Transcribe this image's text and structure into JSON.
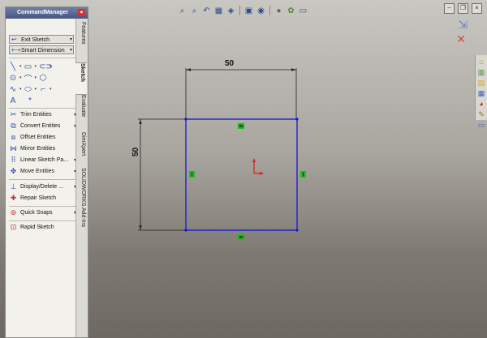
{
  "command_manager": {
    "title": "CommandManager",
    "exit_sketch": "Exit Sketch",
    "smart_dimension": "Smart Dimension",
    "commands": [
      {
        "label": "Trim Entities",
        "icon": "trim-icon",
        "has_dropdown": true
      },
      {
        "label": "Convert Entities",
        "icon": "convert-icon",
        "has_dropdown": true
      },
      {
        "label": "Offset Entities",
        "icon": "offset-icon",
        "has_dropdown": false
      },
      {
        "label": "Mirror Entities",
        "icon": "mirror-icon",
        "has_dropdown": false
      },
      {
        "label": "Linear Sketch Pa...",
        "icon": "linear-pattern-icon",
        "has_dropdown": true
      },
      {
        "label": "Move Entities",
        "icon": "move-icon",
        "has_dropdown": true
      },
      {
        "label": "Display/Delete ...",
        "icon": "display-delete-icon",
        "has_dropdown": true
      },
      {
        "label": "Repair Sketch",
        "icon": "repair-icon",
        "has_dropdown": false
      },
      {
        "label": "Quick Snaps",
        "icon": "quick-snaps-icon",
        "has_dropdown": true
      },
      {
        "label": "Rapid Sketch",
        "icon": "rapid-sketch-icon",
        "has_dropdown": false
      }
    ],
    "tabs": [
      "Features",
      "Sketch",
      "Evaluate",
      "DimXpert",
      "SOLIDWORKS Add-Ins"
    ],
    "active_tab": "Sketch"
  },
  "sketch": {
    "horizontal_dimension": "50",
    "vertical_dimension": "50",
    "line_color": "#1515d8"
  },
  "colors": {
    "relation_marker": "#22b822",
    "origin_red": "#e02020"
  }
}
